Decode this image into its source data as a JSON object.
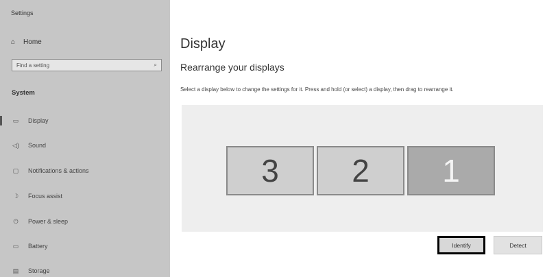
{
  "app": {
    "title": "Settings"
  },
  "sidebar": {
    "home_label": "Home",
    "search_placeholder": "Find a setting",
    "section_label": "System",
    "items": [
      {
        "label": "Display",
        "icon": "monitor-icon"
      },
      {
        "label": "Sound",
        "icon": "speaker-icon"
      },
      {
        "label": "Notifications & actions",
        "icon": "notification-icon"
      },
      {
        "label": "Focus assist",
        "icon": "moon-icon"
      },
      {
        "label": "Power & sleep",
        "icon": "power-icon"
      },
      {
        "label": "Battery",
        "icon": "battery-icon"
      },
      {
        "label": "Storage",
        "icon": "storage-icon"
      }
    ]
  },
  "main": {
    "title": "Display",
    "subtitle": "Rearrange your displays",
    "description": "Select a display below to change the settings for it. Press and hold (or select) a display, then drag to rearrange it.",
    "monitors": [
      "3",
      "2",
      "1"
    ],
    "identify_label": "Identify",
    "detect_label": "Detect"
  }
}
